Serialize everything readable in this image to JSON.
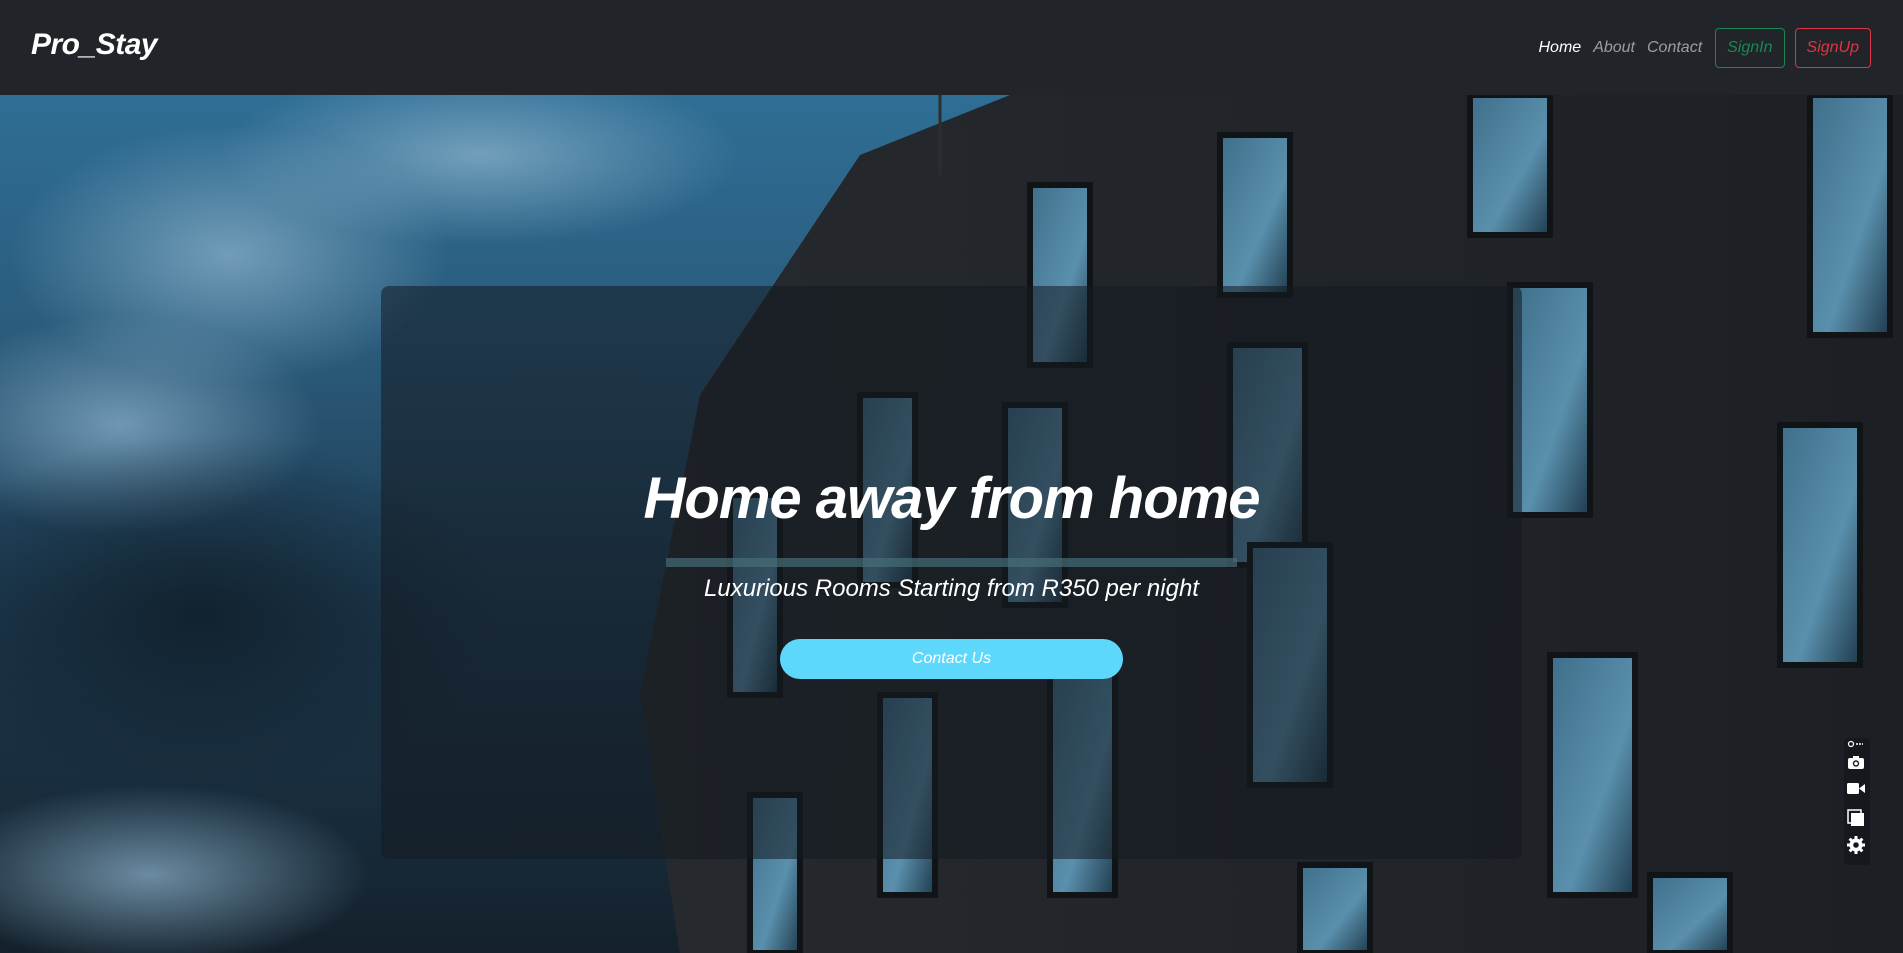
{
  "navbar": {
    "brand": "Pro_Stay",
    "links": [
      {
        "label": "Home",
        "active": true
      },
      {
        "label": "About",
        "active": false
      },
      {
        "label": "Contact",
        "active": false
      }
    ],
    "signin_label": "SignIn",
    "signup_label": "SignUp"
  },
  "hero": {
    "title": "Home away from home",
    "subtitle": "Luxurious Rooms Starting from R350 per night",
    "cta_label": "Contact Us"
  },
  "toolbar": {
    "items": [
      "pin-icon",
      "camera-icon",
      "video-icon",
      "copy-icon",
      "gear-icon"
    ]
  },
  "colors": {
    "navbar_bg": "#212529",
    "signin": "#198754",
    "signup": "#dc3545",
    "cta": "#5dd8fb"
  }
}
